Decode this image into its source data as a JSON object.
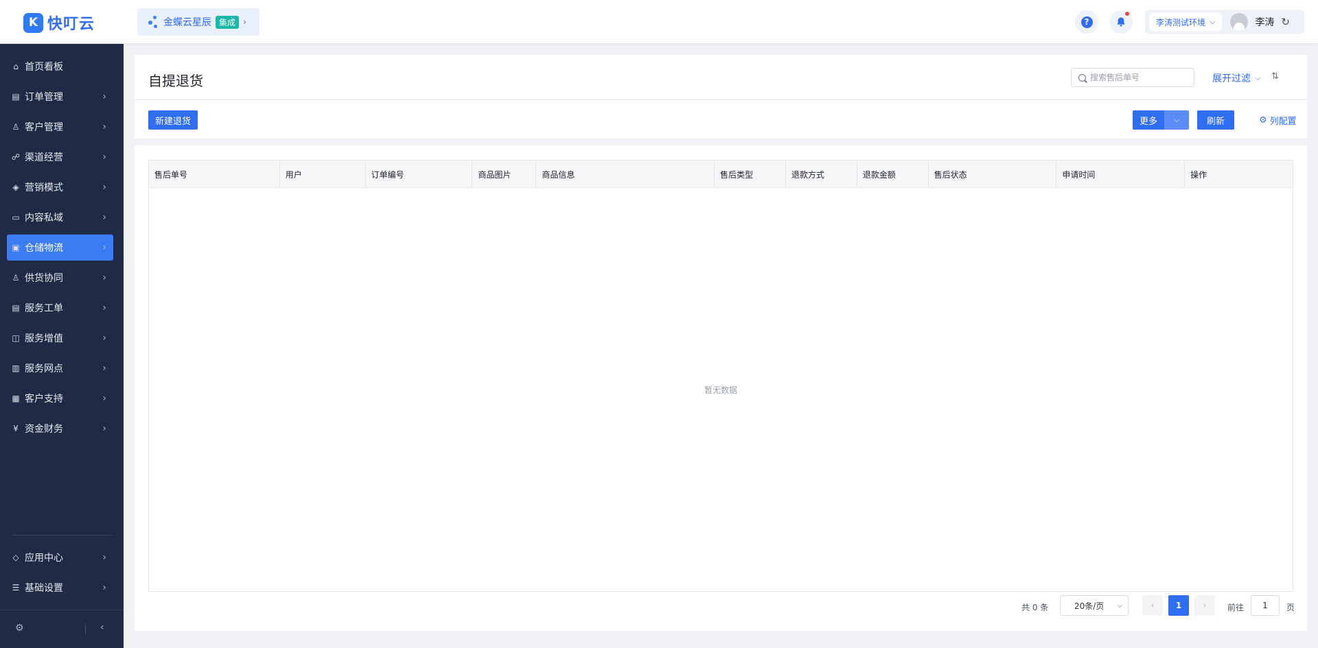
{
  "app": {
    "name": "快叮云",
    "logo_mark": "K"
  },
  "integration": {
    "label": "金蝶云星辰",
    "tag": "集成",
    "arrow": "›"
  },
  "header": {
    "help_glyph": "?",
    "env_label": "李涛测试环境",
    "user_name": "李涛",
    "refresh_glyph": "↻",
    "chevron_glyph": "⌵"
  },
  "sidebar": {
    "items": [
      {
        "label": "首页看板",
        "icon": "home-icon",
        "glyph": "⌂",
        "has_arrow": false
      },
      {
        "label": "订单管理",
        "icon": "clipboard-icon",
        "glyph": "▤",
        "has_arrow": true
      },
      {
        "label": "客户管理",
        "icon": "user-icon",
        "glyph": "♙",
        "has_arrow": true
      },
      {
        "label": "渠道经营",
        "icon": "channel-icon",
        "glyph": "☍",
        "has_arrow": true
      },
      {
        "label": "营销模式",
        "icon": "tag-icon",
        "glyph": "◈",
        "has_arrow": true
      },
      {
        "label": "内容私域",
        "icon": "image-icon",
        "glyph": "▭",
        "has_arrow": true
      },
      {
        "label": "仓储物流",
        "icon": "warehouse-icon",
        "glyph": "▣",
        "has_arrow": true,
        "active": true
      },
      {
        "label": "供货协同",
        "icon": "supply-icon",
        "glyph": "♙",
        "has_arrow": true
      },
      {
        "label": "服务工单",
        "icon": "ticket-icon",
        "glyph": "▤",
        "has_arrow": true
      },
      {
        "label": "服务增值",
        "icon": "bag-icon",
        "glyph": "◫",
        "has_arrow": true
      },
      {
        "label": "服务网点",
        "icon": "store-icon",
        "glyph": "▥",
        "has_arrow": true
      },
      {
        "label": "客户支持",
        "icon": "support-icon",
        "glyph": "▦",
        "has_arrow": true
      },
      {
        "label": "资金财务",
        "icon": "yen-icon",
        "glyph": "¥",
        "has_arrow": true
      }
    ],
    "bottom_items": [
      {
        "label": "应用中心",
        "icon": "cube-icon",
        "glyph": "◇",
        "has_arrow": true
      },
      {
        "label": "基础设置",
        "icon": "sliders-icon",
        "glyph": "☰",
        "has_arrow": true
      }
    ],
    "arrow_glyph": "›",
    "footer_gear_glyph": "⚙",
    "collapse_glyph": "‹"
  },
  "page": {
    "title": "自提退货",
    "search_placeholder": "搜索售后单号",
    "filter_label": "展开过滤",
    "sort_glyph": "⇅",
    "new_button": "新建退货",
    "more_button": "更多",
    "refresh_button": "刷新",
    "column_config": "列配置",
    "gear_glyph": "⚙"
  },
  "table": {
    "columns": [
      {
        "label": "售后单号"
      },
      {
        "label": "用户"
      },
      {
        "label": "订单编号"
      },
      {
        "label": "商品图片"
      },
      {
        "label": "商品信息"
      },
      {
        "label": "售后类型"
      },
      {
        "label": "退款方式"
      },
      {
        "label": "退款金额"
      },
      {
        "label": "售后状态"
      },
      {
        "label": "申请时间"
      },
      {
        "label": "操作"
      }
    ],
    "empty_text": "暂无数据"
  },
  "pagination": {
    "total_text": "共 0 条",
    "page_size": "20条/页",
    "current_page": "1",
    "goto_label": "前往",
    "goto_value": "1",
    "page_suffix": "页",
    "prev_glyph": "‹",
    "next_glyph": "›"
  },
  "colors": {
    "primary": "#2f6df2",
    "sidebar_bg": "#1f2a44",
    "active_bg": "#3b7cf5",
    "badge": "#f0483e"
  }
}
